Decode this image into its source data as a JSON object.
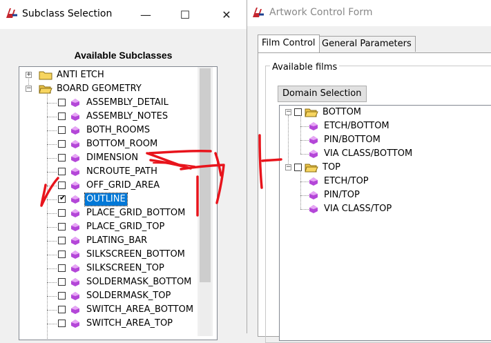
{
  "artwork_window": {
    "title": "Artwork Control Form",
    "tabs": [
      {
        "label": "Film Control",
        "active": true
      },
      {
        "label": "General Parameters",
        "active": false
      }
    ],
    "group_label": "Available films",
    "domain_button": "Domain Selection",
    "films": [
      {
        "name": "BOTTOM",
        "children": [
          "ETCH/BOTTOM",
          "PIN/BOTTOM",
          "VIA CLASS/BOTTOM"
        ]
      },
      {
        "name": "TOP",
        "children": [
          "ETCH/TOP",
          "PIN/TOP",
          "VIA CLASS/TOP"
        ]
      }
    ]
  },
  "subclass_window": {
    "title": "Subclass Selection",
    "controls": {
      "minimize": "—",
      "maximize": "☐",
      "close": "✕"
    },
    "heading": "Available Subclasses",
    "tree": [
      {
        "label": "ANTI ETCH",
        "expanded": false
      },
      {
        "label": "BOARD GEOMETRY",
        "expanded": true,
        "children": [
          {
            "label": "ASSEMBLY_DETAIL",
            "checked": false
          },
          {
            "label": "ASSEMBLY_NOTES",
            "checked": false
          },
          {
            "label": "BOTH_ROOMS",
            "checked": false
          },
          {
            "label": "BOTTOM_ROOM",
            "checked": false
          },
          {
            "label": "DIMENSION",
            "checked": false
          },
          {
            "label": "NCROUTE_PATH",
            "checked": false
          },
          {
            "label": "OFF_GRID_AREA",
            "checked": false
          },
          {
            "label": "OUTLINE",
            "checked": true,
            "selected": true
          },
          {
            "label": "PLACE_GRID_BOTTOM",
            "checked": false
          },
          {
            "label": "PLACE_GRID_TOP",
            "checked": false
          },
          {
            "label": "PLATING_BAR",
            "checked": false
          },
          {
            "label": "SILKSCREEN_BOTTOM",
            "checked": false
          },
          {
            "label": "SILKSCREEN_TOP",
            "checked": false
          },
          {
            "label": "SOLDERMASK_BOTTOM",
            "checked": false
          },
          {
            "label": "SOLDERMASK_TOP",
            "checked": false
          },
          {
            "label": "SWITCH_AREA_BOTTOM",
            "checked": false
          },
          {
            "label": "SWITCH_AREA_TOP",
            "checked": false
          }
        ]
      }
    ]
  },
  "colors": {
    "selection": "#0078d7",
    "annotation": "#e8141c",
    "folder": "#f7d560",
    "gem": "#b447d8"
  }
}
